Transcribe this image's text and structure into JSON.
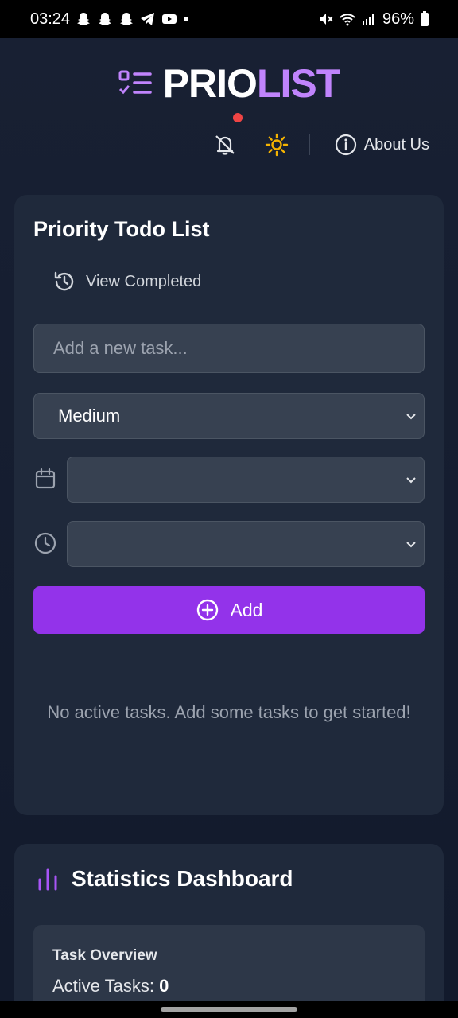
{
  "status_bar": {
    "time": "03:24",
    "battery": "96%",
    "left_icons": [
      "snapchat-icon",
      "snapchat-icon",
      "snapchat-icon",
      "telegram-icon",
      "youtube-icon",
      "dot-icon"
    ],
    "right_icons": [
      "mute-icon",
      "wifi-icon",
      "signal-icon",
      "battery-icon"
    ]
  },
  "header": {
    "logo_part1": "PRIO",
    "logo_part2": "LIST",
    "about_label": "About Us",
    "notifications_muted": true,
    "notification_dot": true
  },
  "todo_card": {
    "title": "Priority Todo List",
    "view_completed_label": "View Completed",
    "task_placeholder": "Add a new task...",
    "priority_selected": "Medium",
    "date_value": "",
    "time_value": "",
    "add_label": "Add",
    "empty_message": "No active tasks. Add some tasks to get started!"
  },
  "stats_card": {
    "title": "Statistics Dashboard",
    "overview_title": "Task Overview",
    "active_tasks_label": "Active Tasks:",
    "active_tasks_value": "0"
  },
  "colors": {
    "accent": "#9333ea",
    "logo_accent": "#c084fc",
    "sun": "#f5b301",
    "notification_dot": "#ef4444",
    "background": "#141c2e",
    "card": "#1f293b"
  }
}
